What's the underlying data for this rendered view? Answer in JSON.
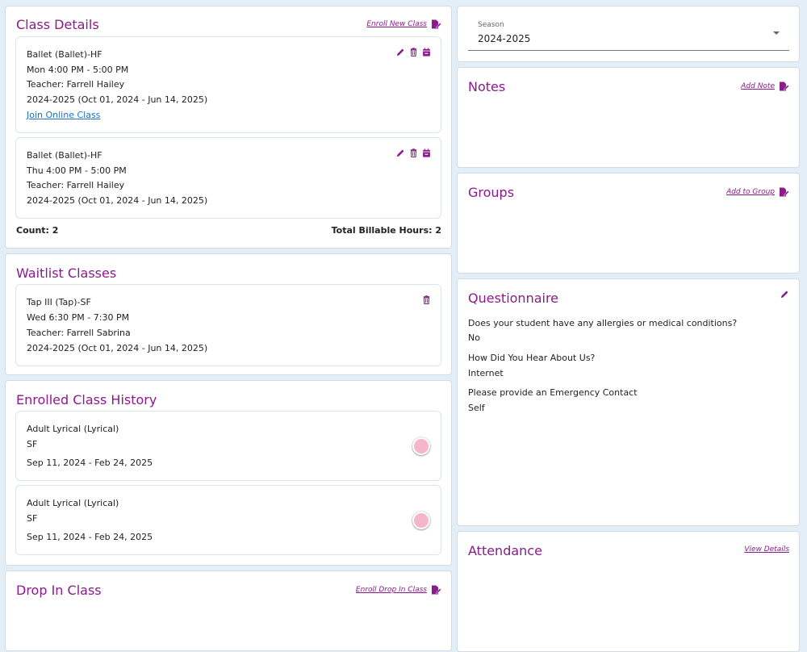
{
  "colors": {
    "accent": "#8b1a8b",
    "link": "#1a73c8",
    "background": "#e3eef7",
    "toggle": "#f5b6cc"
  },
  "class_details": {
    "title": "Class Details",
    "action_label": "Enroll New Class",
    "classes": [
      {
        "name": "Ballet (Ballet)-HF",
        "schedule": "Mon 4:00 PM - 5:00 PM",
        "teacher": "Teacher: Farrell Hailey",
        "season": "2024-2025 (Oct 01, 2024 - Jun 14, 2025)",
        "link": "Join Online Class"
      },
      {
        "name": "Ballet (Ballet)-HF",
        "schedule": "Thu 4:00 PM - 5:00 PM",
        "teacher": "Teacher: Farrell Hailey",
        "season": "2024-2025 (Oct 01, 2024 - Jun 14, 2025)"
      }
    ],
    "count_label": "Count: 2",
    "billable_label": "Total Billable Hours: 2"
  },
  "waitlist": {
    "title": "Waitlist Classes",
    "classes": [
      {
        "name": "Tap III (Tap)-SF",
        "schedule": "Wed 6:30 PM - 7:30 PM",
        "teacher": "Teacher: Farrell Sabrina",
        "season": "2024-2025 (Oct 01, 2024 - Jun 14, 2025)"
      }
    ]
  },
  "history": {
    "title": "Enrolled Class History",
    "items": [
      {
        "name": "Adult Lyrical (Lyrical)",
        "location": "SF",
        "dates": "Sep 11, 2024 - Feb 24, 2025"
      },
      {
        "name": "Adult Lyrical (Lyrical)",
        "location": "SF",
        "dates": "Sep 11, 2024 - Feb 24, 2025"
      }
    ]
  },
  "drop_in": {
    "title": "Drop In Class",
    "action_label": "Enroll Drop In Class"
  },
  "season": {
    "label": "Season",
    "value": "2024-2025"
  },
  "notes": {
    "title": "Notes",
    "action_label": "Add Note"
  },
  "groups": {
    "title": "Groups",
    "action_label": "Add to Group"
  },
  "questionnaire": {
    "title": "Questionnaire",
    "items": [
      {
        "question": "Does your student have any allergies or medical conditions?",
        "answer": "No"
      },
      {
        "question": "How Did You Hear About Us?",
        "answer": "Internet"
      },
      {
        "question": "Please provide an Emergency Contact",
        "answer": "Self"
      }
    ]
  },
  "attendance": {
    "title": "Attendance",
    "action_label": "View Details"
  },
  "icons": {
    "edit": "pencil-icon",
    "delete": "trash-icon",
    "calendar": "calendar-remove-icon",
    "enroll": "edit-document-icon"
  }
}
